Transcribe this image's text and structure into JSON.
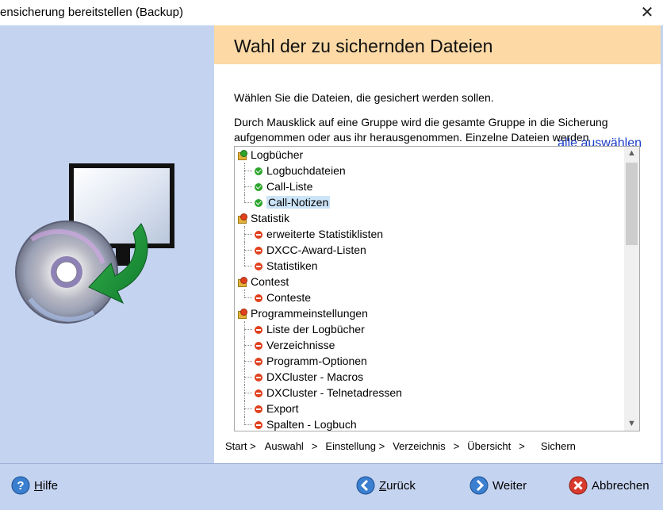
{
  "window": {
    "title": "ensicherung bereitstellen (Backup)",
    "close_glyph": "✕"
  },
  "header": {
    "title": "Wahl der zu sichernden Dateien"
  },
  "intro": {
    "line1": "Wählen Sie die Dateien, die gesichert werden sollen.",
    "line2": "Durch Mausklick auf eine Gruppe wird die gesamte Gruppe in die Sicherung aufgenommen oder aus ihr herausgenommen. Einzelne Dateien werden",
    "select_all": "alle auswählen"
  },
  "tree": {
    "groups": [
      {
        "label": "Logbücher",
        "status": "green",
        "items": [
          {
            "label": "Logbuchdateien",
            "status": "green"
          },
          {
            "label": "Call-Liste",
            "status": "green"
          },
          {
            "label": "Call-Notizen",
            "status": "green",
            "selected": true
          }
        ]
      },
      {
        "label": "Statistik",
        "status": "red",
        "items": [
          {
            "label": "erweiterte Statistiklisten",
            "status": "red"
          },
          {
            "label": "DXCC-Award-Listen",
            "status": "red"
          },
          {
            "label": "Statistiken",
            "status": "red"
          }
        ]
      },
      {
        "label": "Contest",
        "status": "red",
        "items": [
          {
            "label": "Conteste",
            "status": "red"
          }
        ]
      },
      {
        "label": "Programmeinstellungen",
        "status": "red",
        "items": [
          {
            "label": "Liste der Logbücher",
            "status": "red"
          },
          {
            "label": "Verzeichnisse",
            "status": "red"
          },
          {
            "label": "Programm-Optionen",
            "status": "red"
          },
          {
            "label": "DXCluster - Macros",
            "status": "red"
          },
          {
            "label": "DXCluster - Telnetadressen",
            "status": "red"
          },
          {
            "label": "Export",
            "status": "red"
          },
          {
            "label": "Spalten - Logbuch",
            "status": "red"
          }
        ]
      }
    ]
  },
  "steps": {
    "items": [
      "Start >",
      "Auswahl",
      ">",
      "Einstellung >",
      "Verzeichnis",
      ">",
      "Übersicht",
      ">",
      "Sichern"
    ]
  },
  "buttons": {
    "help_mnemonic": "H",
    "help_rest": "ilfe",
    "back_mnemonic": "Z",
    "back_rest": "urück",
    "next": "Weiter",
    "cancel": "Abbrechen"
  },
  "colors": {
    "side_panel": "#c4d3f0",
    "header_band": "#fcd9a5",
    "link": "#1a3cc8",
    "status_green": "#2da52d",
    "status_red": "#e0401c",
    "selection": "#cce4f7"
  },
  "icons": {
    "close": "close-icon",
    "illustration": "backup-cd-monitor-illustration",
    "help": "help-question-icon",
    "back": "back-arrow-icon",
    "next": "next-arrow-icon",
    "cancel": "cancel-x-icon"
  }
}
